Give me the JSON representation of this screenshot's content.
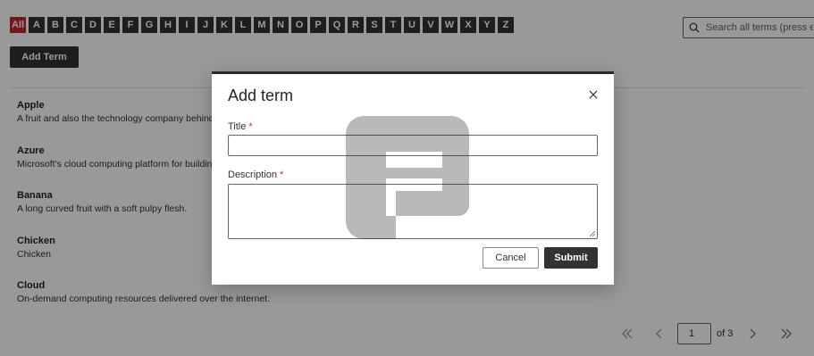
{
  "alphabet": {
    "letters": [
      "All",
      "A",
      "B",
      "C",
      "D",
      "E",
      "F",
      "G",
      "H",
      "I",
      "J",
      "K",
      "L",
      "M",
      "N",
      "O",
      "P",
      "Q",
      "R",
      "S",
      "T",
      "U",
      "V",
      "W",
      "X",
      "Y",
      "Z"
    ],
    "active": "All",
    "active_color": "#c4262e"
  },
  "search": {
    "placeholder": "Search all terms (press e..."
  },
  "toolbar": {
    "add_label": "Add Term"
  },
  "terms": [
    {
      "title": "Apple",
      "description": "A fruit and also the technology company behind the iPhone."
    },
    {
      "title": "Azure",
      "description": "Microsoft's cloud computing platform for building and deploying applications."
    },
    {
      "title": "Banana",
      "description": "A long curved fruit with a soft pulpy flesh."
    },
    {
      "title": "Chicken",
      "description": "Chicken"
    },
    {
      "title": "Cloud",
      "description": "On-demand computing resources delivered over the internet."
    }
  ],
  "pager": {
    "current": "1",
    "of_label": "of 3"
  },
  "dialog": {
    "title": "Add term",
    "title_label": "Title",
    "description_label": "Description",
    "required_mark": "*",
    "cancel_label": "Cancel",
    "submit_label": "Submit"
  },
  "icons": {
    "search": "search-icon",
    "close": "close-icon",
    "first": "chevron-double-left-icon",
    "prev": "chevron-left-icon",
    "next": "chevron-right-icon",
    "last": "chevron-double-right-icon"
  },
  "colors": {
    "dark_button": "#333333",
    "accent_red": "#c4262e"
  }
}
